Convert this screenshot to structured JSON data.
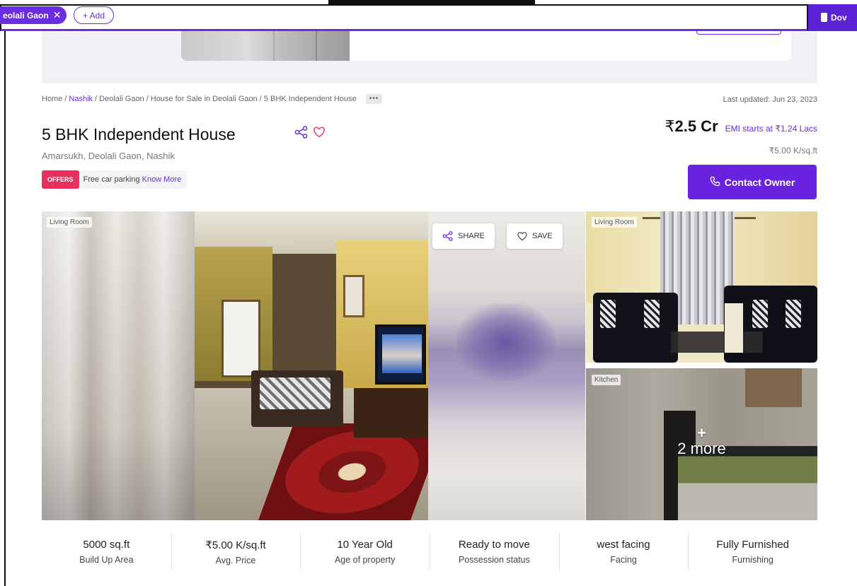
{
  "topbar": {
    "location_chip": "eolali Gaon",
    "add_label": "+ Add",
    "download_label": "Dov"
  },
  "breadcrumb": {
    "home": "Home",
    "city": "Nashik",
    "locality": "Deolali Gaon",
    "category": "House for Sale in Deolali Gaon",
    "current": "5 BHK Independent House",
    "more": "•••"
  },
  "last_updated": "Last updated: Jun 23, 2023",
  "listing": {
    "title": "5 BHK Independent House",
    "address": "Amarsukh, Deolali Gaon, Nashik",
    "offer_badge": "OFFERS",
    "offer_text": "Free car parking",
    "offer_link": "Know More",
    "price_symbol": "₹",
    "price_value": "2.5 Cr",
    "emi": "EMI starts at ₹1.24 Lacs",
    "price_per_sqft": "₹5.00 K/sq.ft",
    "contact_label": "Contact Owner"
  },
  "gallery": {
    "tag_left": "Living Room",
    "tag_side_top": "Living Room",
    "tag_side_bottom": "Kitchen",
    "share_label": "SHARE",
    "save_label": "SAVE",
    "more_plus": "+",
    "more_text": "2 more"
  },
  "stats": [
    {
      "value": "5000 sq.ft",
      "label": "Build Up Area"
    },
    {
      "value": "₹5.00 K/sq.ft",
      "label": "Avg. Price"
    },
    {
      "value": "10 Year Old",
      "label": "Age of property"
    },
    {
      "value": "Ready to move",
      "label": "Possession status"
    },
    {
      "value": "west facing",
      "label": "Facing"
    },
    {
      "value": "Fully Furnished",
      "label": "Furnishing"
    }
  ],
  "colors": {
    "accent": "#6a2ee0",
    "offer_badge": "#e8305f"
  }
}
